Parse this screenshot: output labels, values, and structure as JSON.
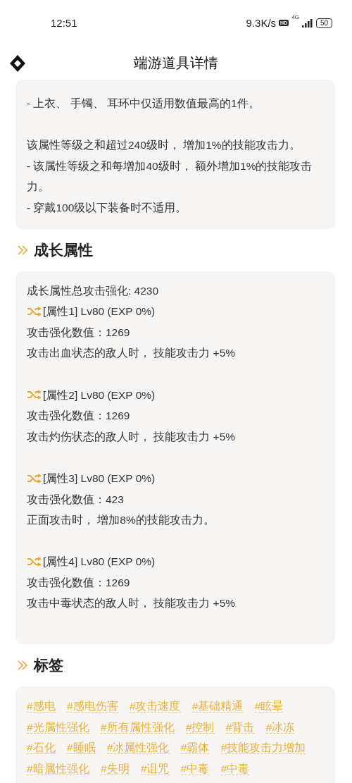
{
  "status_bar": {
    "time": "12:51",
    "network_speed": "9.3K/s",
    "hd_badge": "HD",
    "network_type": "4G",
    "battery": "50"
  },
  "header": {
    "title": "端游道具详情"
  },
  "effect_card": {
    "paragraphs": [
      [
        "- 上衣、 手镯、 耳环中仅适用数值最高的1件。"
      ],
      [
        "该属性等级之和超过240级时， 增加1%的技能攻击力。",
        "- 该属性等级之和每增加40级时， 额外增加1%的技能攻击力。",
        "- 穿戴100级以下装备时不适用。"
      ]
    ]
  },
  "growth": {
    "title": "成长属性",
    "total": "成长属性总攻击强化: 4230",
    "attributes": [
      {
        "name": "[属性1] Lv80 (EXP 0%)",
        "value": "攻击强化数值：1269",
        "effect": "攻击出血状态的敌人时， 技能攻击力 +5%"
      },
      {
        "name": "[属性2] Lv80 (EXP 0%)",
        "value": "攻击强化数值：1269",
        "effect": "攻击灼伤状态的敌人时， 技能攻击力 +5%"
      },
      {
        "name": "[属性3] Lv80 (EXP 0%)",
        "value": "攻击强化数值：423",
        "effect": "正面攻击时， 增加8%的技能攻击力。"
      },
      {
        "name": "[属性4] Lv80 (EXP 0%)",
        "value": "攻击强化数值：1269",
        "effect": "攻击中毒状态的敌人时， 技能攻击力 +5%"
      }
    ]
  },
  "tags": {
    "title": "标签",
    "items": [
      "#感电",
      "#感电伤害",
      "#攻击速度",
      "#基础精通",
      "#眩晕",
      "#光属性强化",
      "#所有属性强化",
      "#控制",
      "#背击",
      "#冰冻",
      "#石化",
      "#睡眠",
      "#冰属性强化",
      "#霸体",
      "#技能攻击力增加",
      "#暗属性强化",
      "#失明",
      "#诅咒",
      "#中毒",
      "#中毒"
    ]
  }
}
